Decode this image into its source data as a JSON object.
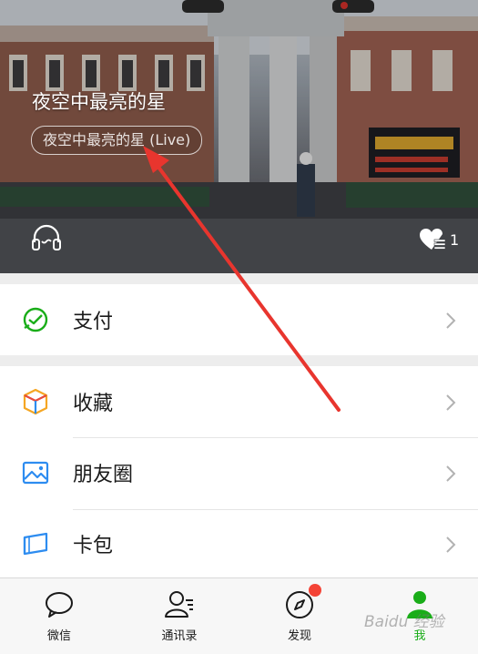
{
  "header": {
    "title": "夜空中最亮的星",
    "song_pill": "夜空中最亮的星 (Live)",
    "like_count": "1"
  },
  "menu": {
    "pay": "支付",
    "favorites": "收藏",
    "moments": "朋友圈",
    "cards": "卡包"
  },
  "tabbar": {
    "chats": "微信",
    "contacts": "通讯录",
    "discover": "发现",
    "me": "我"
  },
  "watermark": "Baidu 经验",
  "colors": {
    "accent_green": "#1aad19",
    "badge_red": "#f44336",
    "annotation_arrow": "#e8352e"
  }
}
